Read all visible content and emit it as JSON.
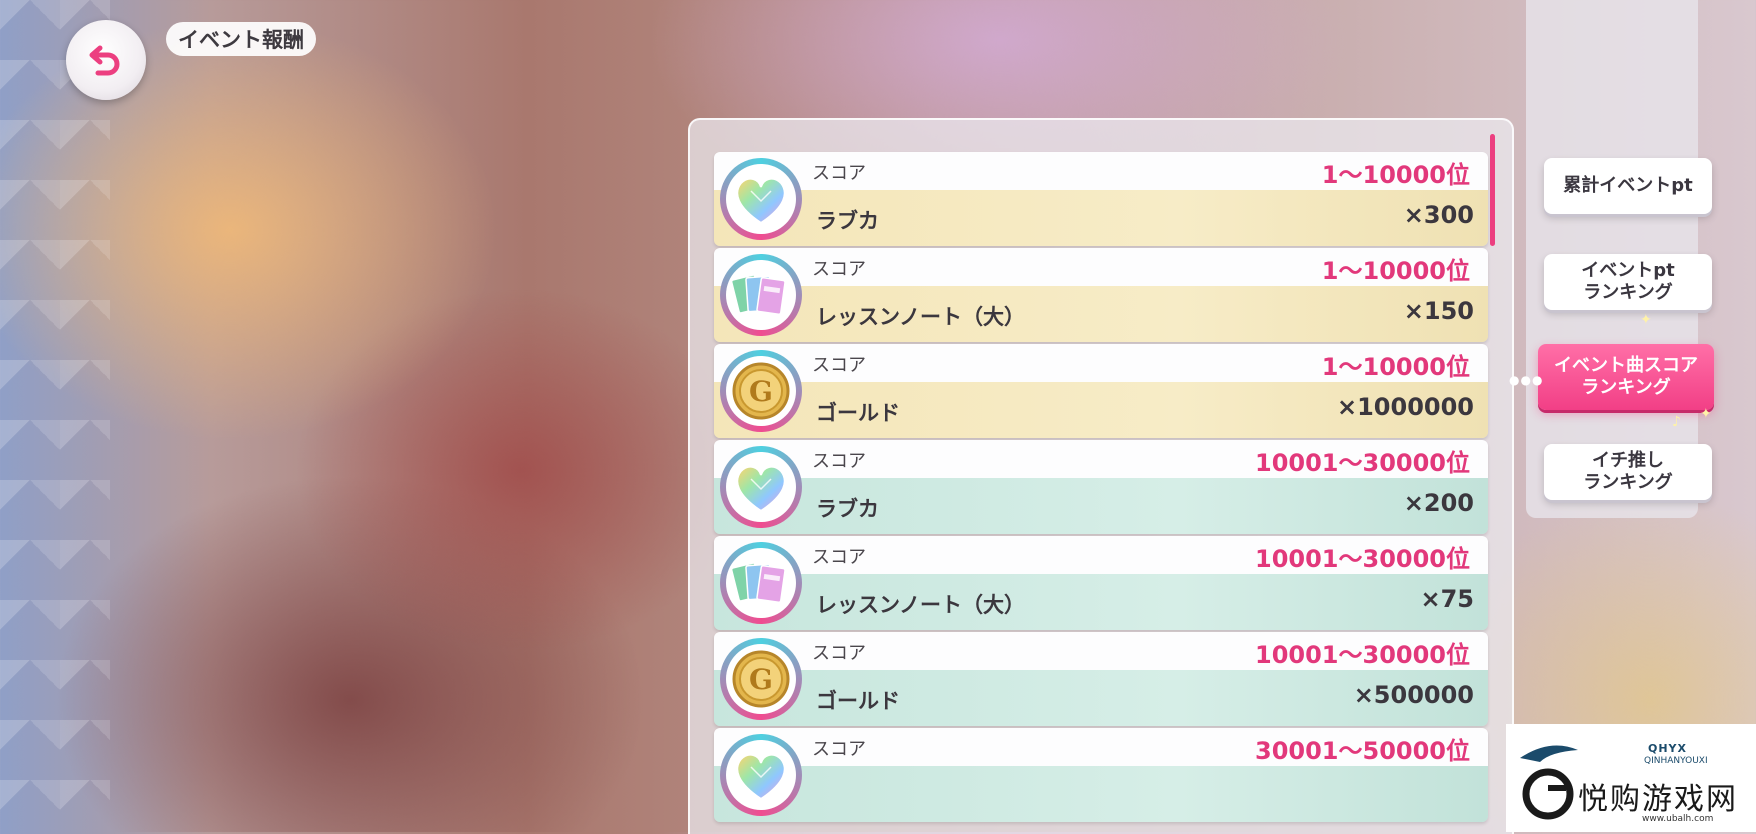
{
  "header": {
    "title": "イベント報酬"
  },
  "tabs": [
    {
      "label_line1": "累計イベントpt",
      "label_line2": ""
    },
    {
      "label_line1": "イベントpt",
      "label_line2": "ランキング"
    },
    {
      "label_line1": "イベント曲スコア",
      "label_line2": "ランキング"
    },
    {
      "label_line1": "イチ推し",
      "label_line2": "ランキング"
    }
  ],
  "active_tab_index": 2,
  "rewards": [
    {
      "category": "スコア",
      "rank": "1～10000位",
      "item": "ラブカ",
      "qty": "×300",
      "icon": "heart-gem-icon",
      "tier": "gold"
    },
    {
      "category": "スコア",
      "rank": "1～10000位",
      "item": "レッスンノート（大）",
      "qty": "×150",
      "icon": "lesson-note-icon",
      "tier": "gold"
    },
    {
      "category": "スコア",
      "rank": "1～10000位",
      "item": "ゴールド",
      "qty": "×1000000",
      "icon": "gold-coin-icon",
      "tier": "gold"
    },
    {
      "category": "スコア",
      "rank": "10001～30000位",
      "item": "ラブカ",
      "qty": "×200",
      "icon": "heart-gem-icon",
      "tier": "mint"
    },
    {
      "category": "スコア",
      "rank": "10001～30000位",
      "item": "レッスンノート（大）",
      "qty": "×75",
      "icon": "lesson-note-icon",
      "tier": "mint"
    },
    {
      "category": "スコア",
      "rank": "10001～30000位",
      "item": "ゴールド",
      "qty": "×500000",
      "icon": "gold-coin-icon",
      "tier": "mint"
    },
    {
      "category": "スコア",
      "rank": "30001～50000位",
      "item": "",
      "qty": "",
      "icon": "heart-gem-icon",
      "tier": "mint"
    }
  ],
  "watermark": {
    "latin": "QHYX",
    "sub": "QINHANYOUXI",
    "chinese": "悦购游戏网",
    "url": "www.ubalh.com"
  },
  "colors": {
    "accent_pink": "#e2387b",
    "active_tab": "#f23f86",
    "gold_band": "#f4e6b9",
    "mint_band": "#c7e6dd"
  }
}
